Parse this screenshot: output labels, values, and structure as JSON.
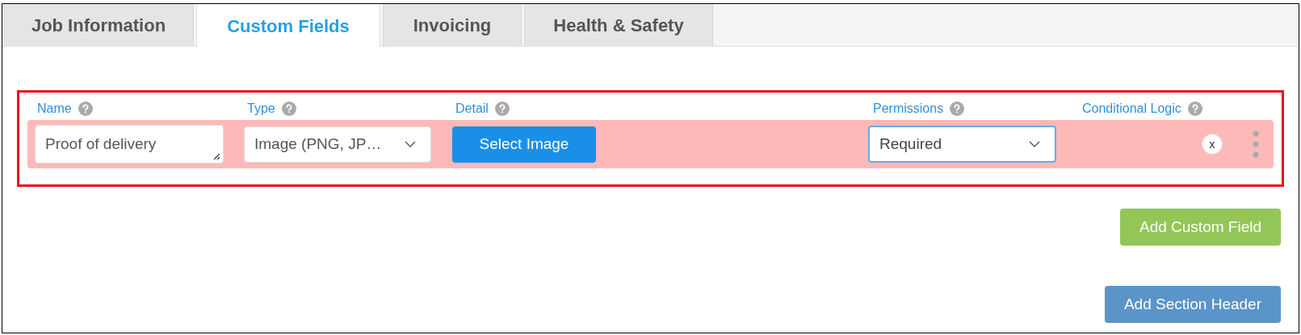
{
  "tabs": [
    {
      "label": "Job Information",
      "selected": false
    },
    {
      "label": "Custom Fields",
      "selected": true
    },
    {
      "label": "Invoicing",
      "selected": false
    },
    {
      "label": "Health & Safety",
      "selected": false
    }
  ],
  "field_headers": [
    {
      "label": "Name"
    },
    {
      "label": "Type"
    },
    {
      "label": "Detail"
    },
    {
      "label": "Permissions"
    },
    {
      "label": "Conditional Logic"
    }
  ],
  "custom_field": {
    "name": "Proof of delivery",
    "type": "Image (PNG, JP…",
    "detail_button": "Select Image",
    "permissions": "Required",
    "remove": "x"
  },
  "buttons": [
    {
      "label": "Add Custom Field",
      "kind": "green"
    },
    {
      "label": "Add Section Header",
      "kind": "blue"
    }
  ]
}
